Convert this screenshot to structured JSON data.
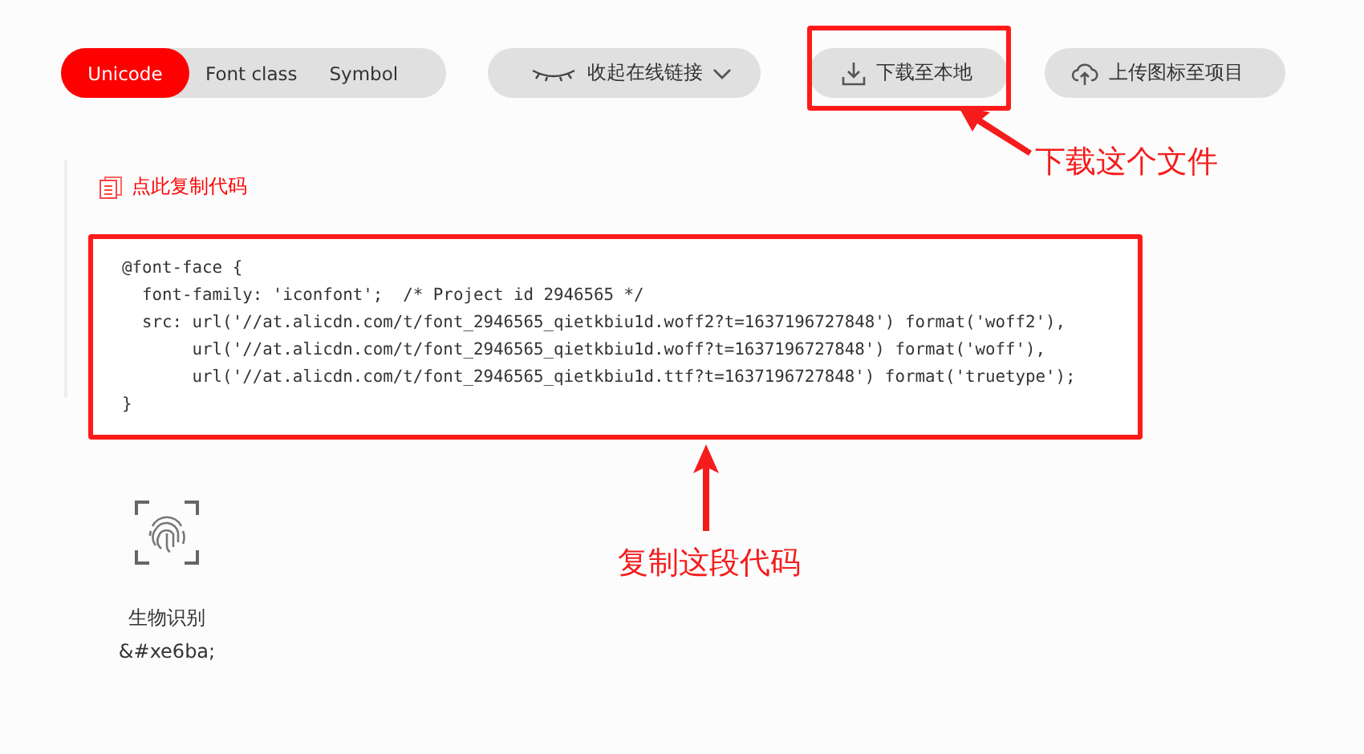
{
  "tabs": [
    {
      "label": "Unicode",
      "selected": true
    },
    {
      "label": "Font class",
      "selected": false
    },
    {
      "label": "Symbol",
      "selected": false
    }
  ],
  "toolbar": {
    "collapse_button": {
      "label": "收起在线链接"
    },
    "download_button": {
      "label": "下载至本地"
    },
    "upload_button": {
      "label": "上传图标至项目"
    }
  },
  "copy_link": {
    "label": "点此复制代码"
  },
  "code_lines": [
    "@font-face {",
    "  font-family: 'iconfont';  /* Project id 2946565 */",
    "  src: url('//at.alicdn.com/t/font_2946565_qietkbiu1d.woff2?t=1637196727848') format('woff2'),",
    "       url('//at.alicdn.com/t/font_2946565_qietkbiu1d.woff?t=1637196727848') format('woff'),",
    "       url('//at.alicdn.com/t/font_2946565_qietkbiu1d.ttf?t=1637196727848') format('truetype');",
    "}"
  ],
  "annotations": [
    {
      "text": "下载这个文件"
    },
    {
      "text": "复制这段代码"
    }
  ],
  "icons": [
    {
      "name": "生物识别",
      "code": "&#xe6ba;"
    }
  ]
}
